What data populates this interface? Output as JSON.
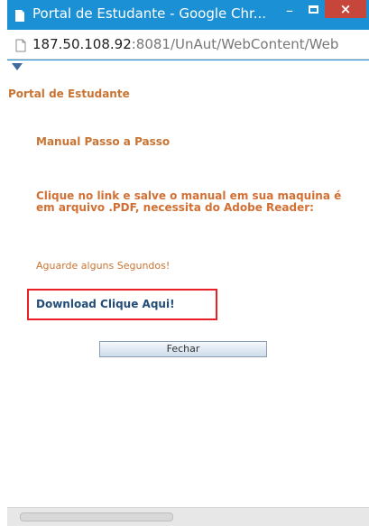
{
  "window": {
    "title": "Portal de Estudante - Google Chr...",
    "controls": {
      "minimize": "–",
      "close": "×"
    },
    "icons": [
      "page-icon",
      "minimize-icon",
      "maximize-icon",
      "close-icon"
    ],
    "colors": {
      "titlebar": "#1b90d5",
      "close": "#c7463b"
    }
  },
  "address": {
    "host": "187.50.108.92",
    "path": ":8081/UnAut/WebContent/Web"
  },
  "page": {
    "portal_title": "Portal de Estudante",
    "manual_title": "Manual Passo a Passo",
    "instruction": "Clique no link e salve o manual em sua maquina é em arquivo .PDF, necessita do Adobe Reader:",
    "wait_text": "Aguarde alguns Segundos!",
    "download_link": "Download Clique Aqui!",
    "close_button": "Fechar",
    "colors": {
      "heading": "#c97433",
      "link": "#234c77",
      "highlight": "#e81f26"
    }
  }
}
